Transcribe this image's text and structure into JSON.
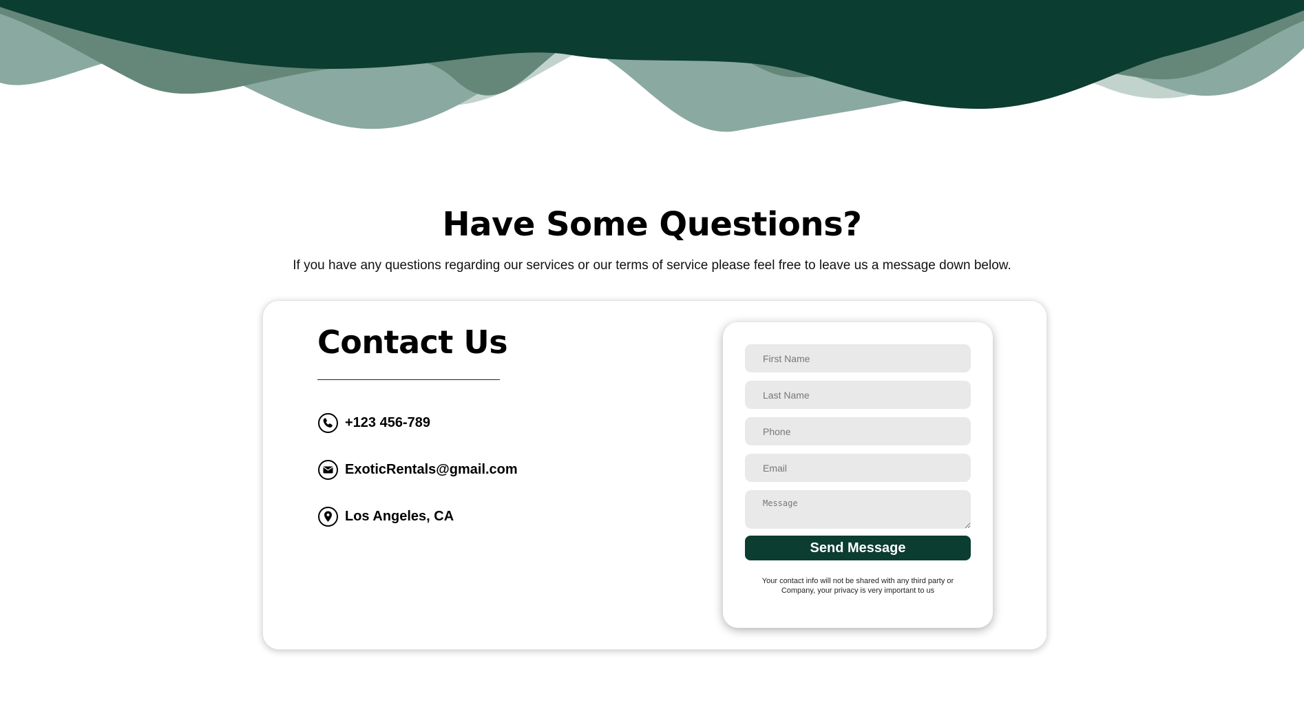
{
  "colors": {
    "brand_dark": "#0b3d30",
    "wave_mid": "#3f6f61",
    "wave_light": "#8aa9a0",
    "wave_lighter": "#c2d3ce",
    "field_bg": "#e9e9e9"
  },
  "hero": {
    "heading": "Have Some Questions?",
    "subtext": "If you have any questions regarding our services or our terms of service please feel free to leave us a message down below."
  },
  "contact": {
    "title": "Contact Us",
    "items": [
      {
        "icon": "phone-icon",
        "text": "+123 456-789"
      },
      {
        "icon": "mail-icon",
        "text": "ExoticRentals@gmail.com"
      },
      {
        "icon": "location-pin-icon",
        "text": "Los Angeles, CA"
      }
    ]
  },
  "form": {
    "first_name_placeholder": "First Name",
    "last_name_placeholder": "Last Name",
    "phone_placeholder": "Phone",
    "email_placeholder": "Email",
    "message_placeholder": "Message",
    "submit_label": "Send Message",
    "privacy_note": "Your contact info will not be shared with any third party or Company, your privacy is very important to us"
  }
}
